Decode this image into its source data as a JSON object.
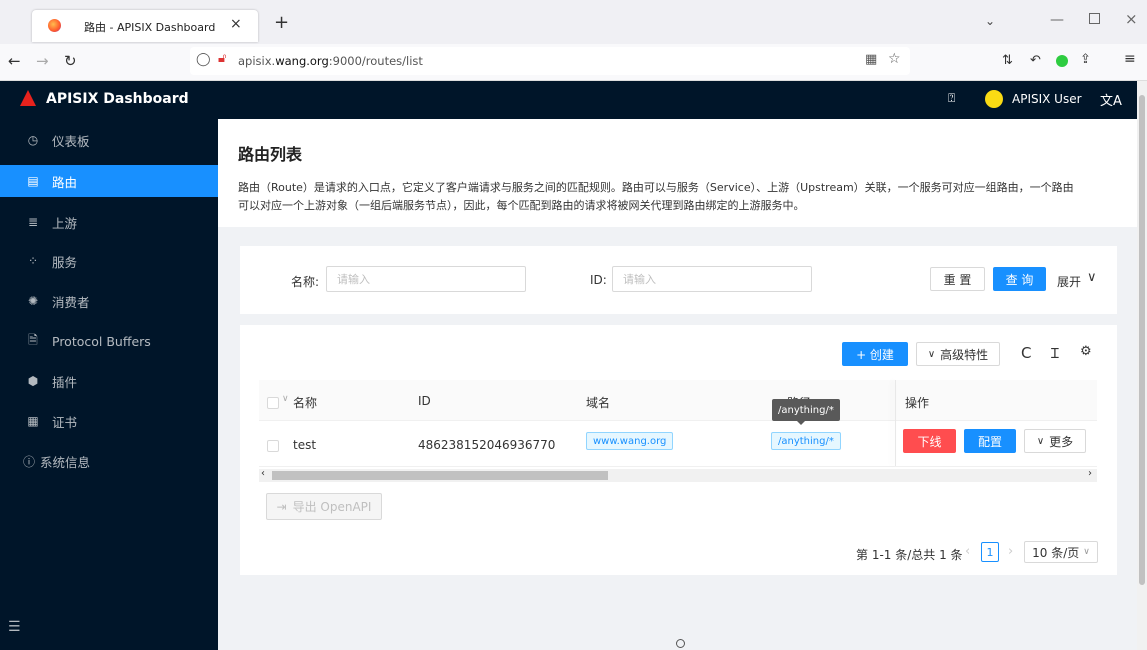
{
  "browser": {
    "tab_title": "路由 - APISIX Dashboard",
    "new_tab": "+",
    "url_prefix": "apisix.",
    "url_host": "wang.org",
    "url_rest": ":9000/routes/list"
  },
  "header": {
    "brand": "APISIX Dashboard",
    "user": "APISIX User"
  },
  "sidebar": {
    "items": [
      {
        "label": "仪表板",
        "icon": "◷"
      },
      {
        "label": "路由",
        "icon": "▤"
      },
      {
        "label": "上游",
        "icon": "≣"
      },
      {
        "label": "服务",
        "icon": "⁘"
      },
      {
        "label": "消费者",
        "icon": "✺"
      },
      {
        "label": "Protocol Buffers",
        "icon": "🗎"
      },
      {
        "label": "插件",
        "icon": "⬢"
      },
      {
        "label": "证书",
        "icon": "▦"
      },
      {
        "label": "系统信息",
        "icon": "ⓘ"
      }
    ]
  },
  "page": {
    "title": "路由列表",
    "description_line1": "路由（Route）是请求的入口点，它定义了客户端请求与服务之间的匹配规则。路由可以与服务（Service）、上游（Upstream）关联，一个服务可对应一组路由，一个路由",
    "description_line2": "可以对应一个上游对象（一组后端服务节点），因此，每个匹配到路由的请求将被网关代理到路由绑定的上游服务中。"
  },
  "search": {
    "name_label": "名称:",
    "name_placeholder": "请输入",
    "id_label": "ID:",
    "id_placeholder": "请输入",
    "reset": "重 置",
    "query": "查 询",
    "expand": "展开"
  },
  "toolbar": {
    "create": "+ 创建",
    "advanced": "高级特性"
  },
  "table": {
    "headers": [
      "名称",
      "ID",
      "域名",
      "路径",
      "操作"
    ],
    "rows": [
      {
        "name": "test",
        "id": "486238152046936770",
        "host": "www.wang.org",
        "path": "/anything/*"
      }
    ],
    "tooltip": "/anything/*",
    "offline": "下线",
    "configure": "配置",
    "more": "更多"
  },
  "export": "导出 OpenAPI",
  "pagination": {
    "summary": "第 1-1 条/总共 1 条",
    "current": "1",
    "page_size": "10 条/页"
  }
}
